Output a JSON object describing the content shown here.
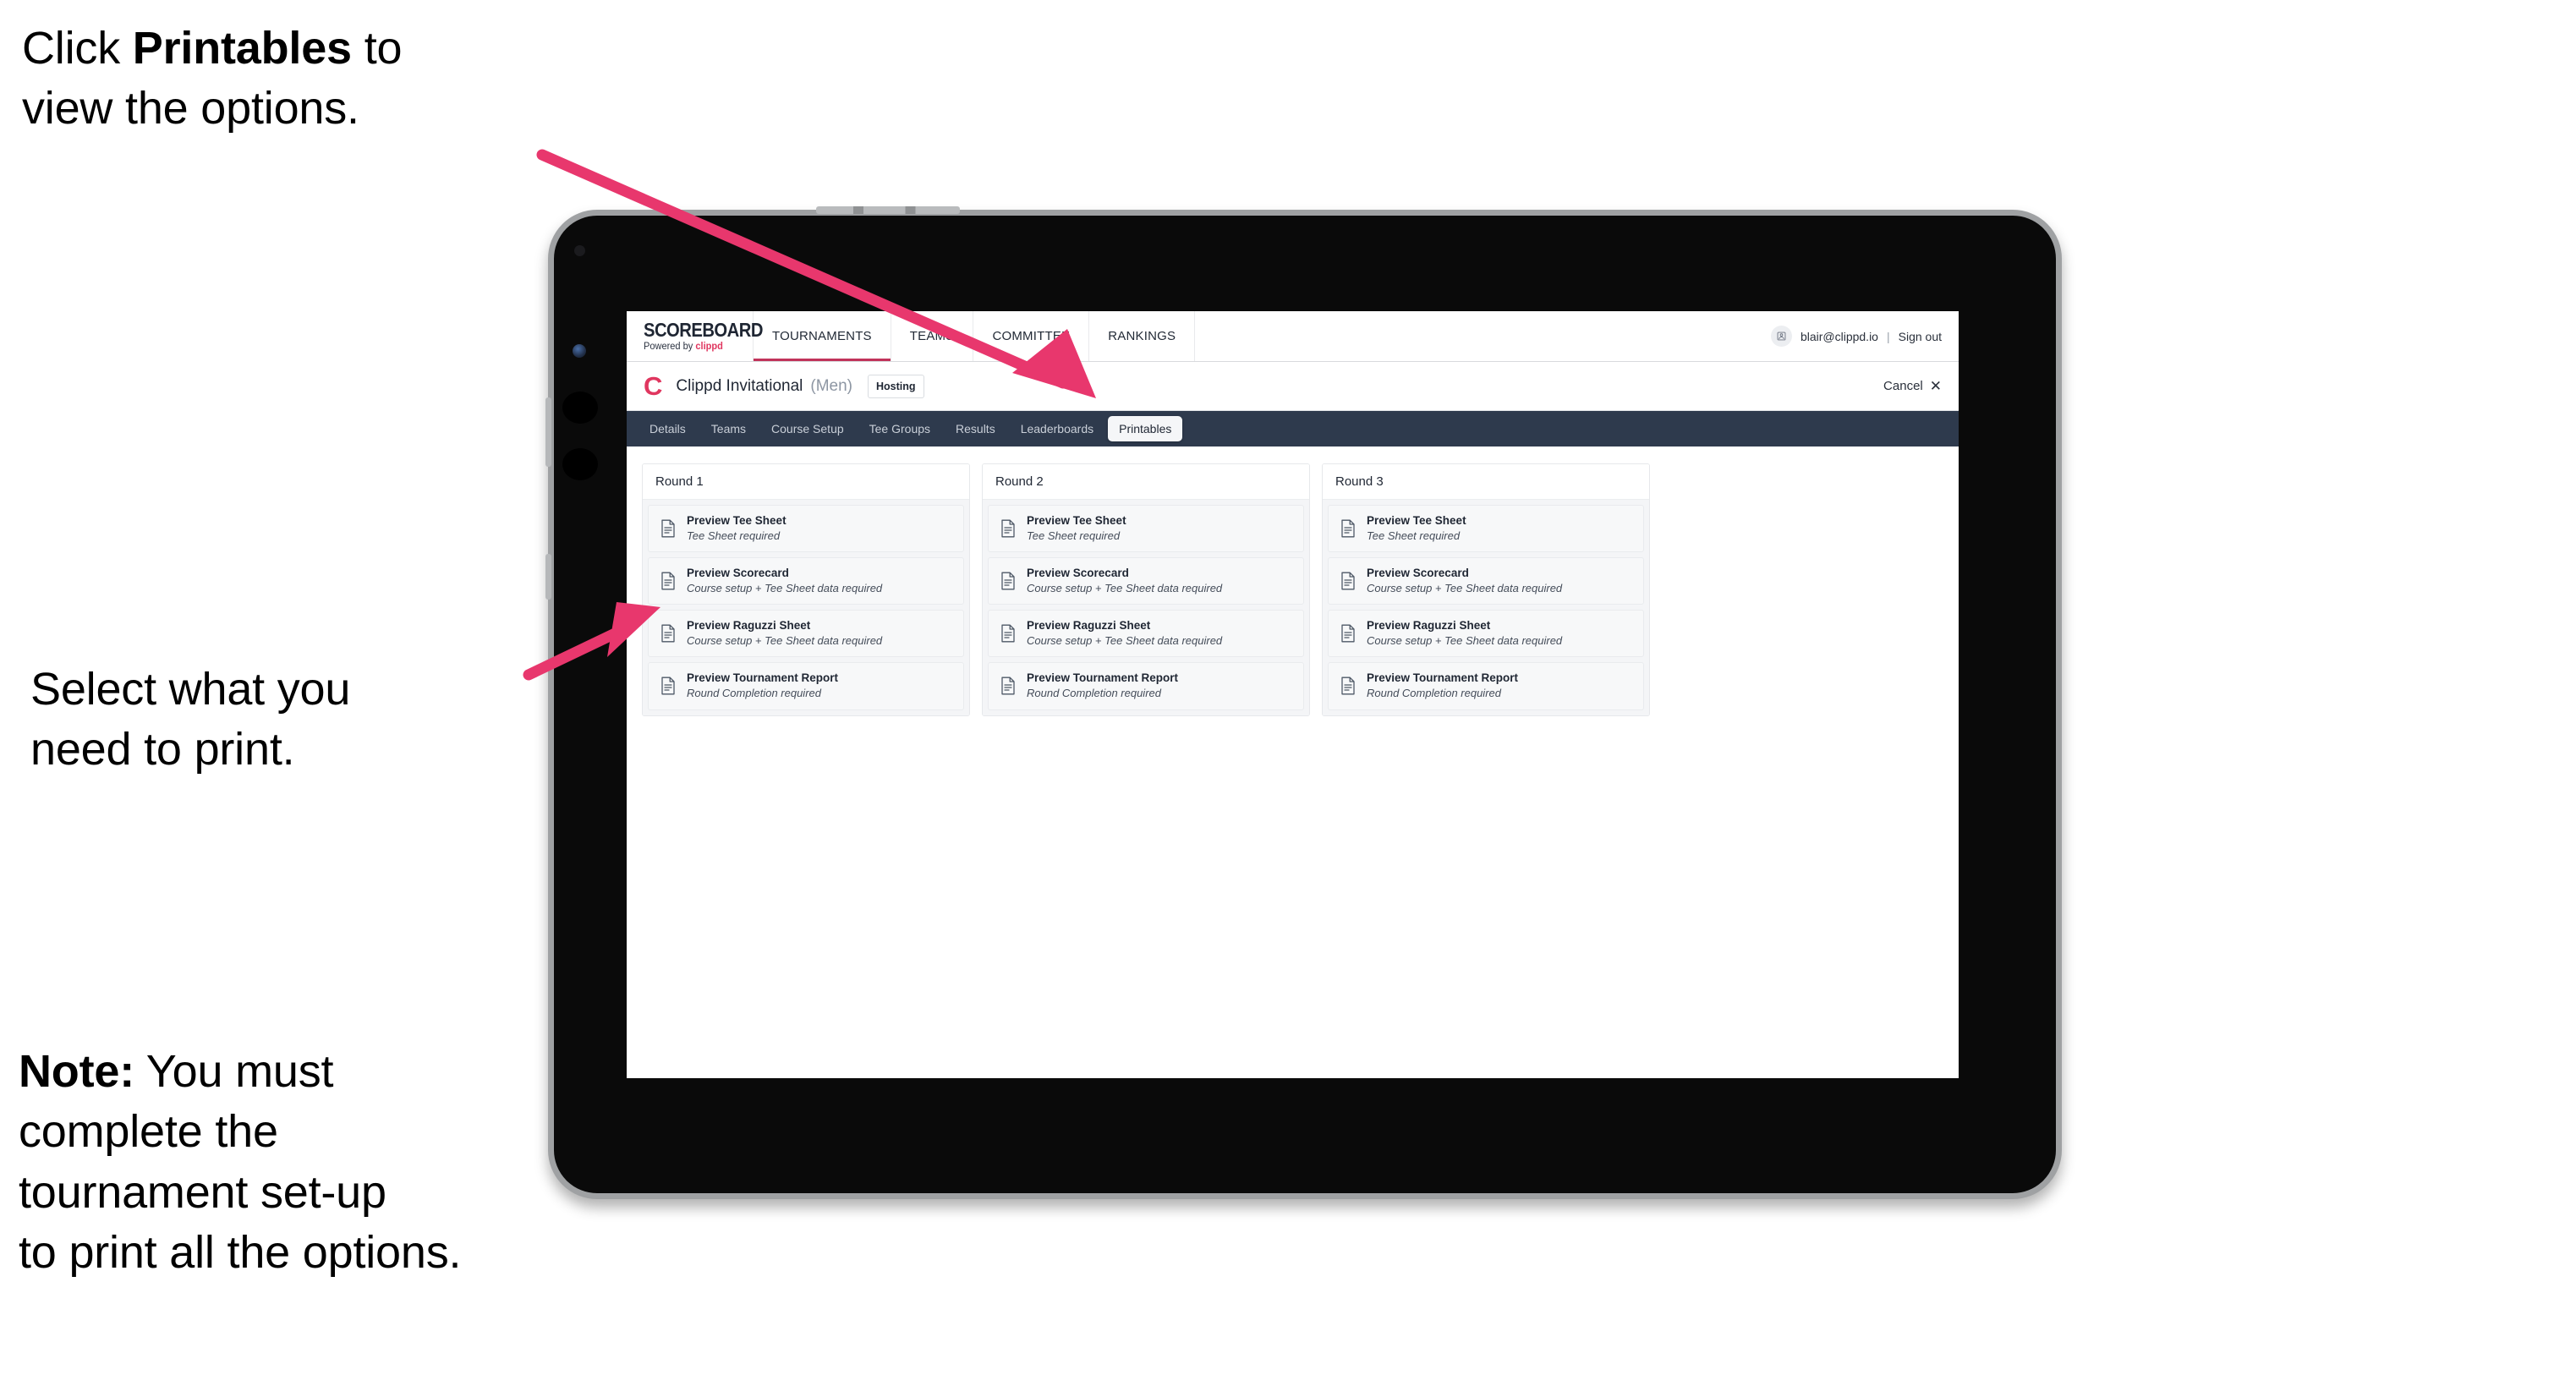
{
  "annotations": {
    "click_printables": {
      "prefix": "Click ",
      "bold": "Printables",
      "suffix": " to\nview the options."
    },
    "select_print": "Select what you\n need to print.",
    "note": {
      "bold": "Note:",
      "rest": " You must\ncomplete the\ntournament set-up\nto print all the options."
    },
    "arrow_color": "#e8376d"
  },
  "app": {
    "brand": {
      "logo_word": "SCOREBOARD",
      "logo_sub_prefix": "Powered by ",
      "logo_sub_brand": "clippd"
    },
    "topnav": [
      {
        "label": "TOURNAMENTS",
        "active": true
      },
      {
        "label": "TEAMS",
        "active": false
      },
      {
        "label": "COMMITTEE",
        "active": false
      },
      {
        "label": "RANKINGS",
        "active": false
      }
    ],
    "account": {
      "avatar_icon": "user-avatar-icon",
      "email": "blair@clippd.io",
      "separator": "|",
      "sign_out": "Sign out"
    },
    "title_row": {
      "logo_mark": "C",
      "tournament_name": "Clippd Invitational",
      "gender": "(Men)",
      "hosting_badge": "Hosting",
      "cancel_label": "Cancel",
      "cancel_icon": "close-icon"
    },
    "subtabs": [
      {
        "label": "Details",
        "active": false
      },
      {
        "label": "Teams",
        "active": false
      },
      {
        "label": "Course Setup",
        "active": false
      },
      {
        "label": "Tee Groups",
        "active": false
      },
      {
        "label": "Results",
        "active": false
      },
      {
        "label": "Leaderboards",
        "active": false
      },
      {
        "label": "Printables",
        "active": true
      }
    ],
    "rounds": [
      {
        "heading": "Round 1",
        "items": [
          {
            "title": "Preview Tee Sheet",
            "sub": "Tee Sheet required"
          },
          {
            "title": "Preview Scorecard",
            "sub": "Course setup + Tee Sheet data required"
          },
          {
            "title": "Preview Raguzzi Sheet",
            "sub": "Course setup + Tee Sheet data required"
          },
          {
            "title": "Preview Tournament Report",
            "sub": "Round Completion required"
          }
        ]
      },
      {
        "heading": "Round 2",
        "items": [
          {
            "title": "Preview Tee Sheet",
            "sub": "Tee Sheet required"
          },
          {
            "title": "Preview Scorecard",
            "sub": "Course setup + Tee Sheet data required"
          },
          {
            "title": "Preview Raguzzi Sheet",
            "sub": "Course setup + Tee Sheet data required"
          },
          {
            "title": "Preview Tournament Report",
            "sub": "Round Completion required"
          }
        ]
      },
      {
        "heading": "Round 3",
        "items": [
          {
            "title": "Preview Tee Sheet",
            "sub": "Tee Sheet required"
          },
          {
            "title": "Preview Scorecard",
            "sub": "Course setup + Tee Sheet data required"
          },
          {
            "title": "Preview Raguzzi Sheet",
            "sub": "Course setup + Tee Sheet data required"
          },
          {
            "title": "Preview Tournament Report",
            "sub": "Round Completion required"
          }
        ]
      }
    ],
    "colors": {
      "navy": "#2e3a4d",
      "brand_pink": "#e0365f",
      "accent_underline": "#c1335a"
    }
  }
}
